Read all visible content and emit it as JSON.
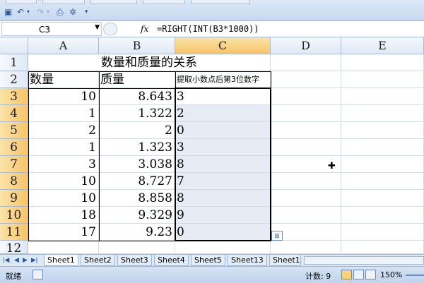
{
  "formula_bar": {
    "name_box": "C3",
    "fx_label": "fx",
    "formula": "=RIGHT(INT(B3*1000))"
  },
  "columns": [
    "A",
    "B",
    "C",
    "D",
    "E"
  ],
  "rows": [
    "1",
    "2",
    "3",
    "4",
    "5",
    "6",
    "7",
    "8",
    "9",
    "10",
    "11",
    "12"
  ],
  "sheet": {
    "title": "数量和质量的关系",
    "header_a": "数量",
    "header_b": "质量",
    "header_c": "提取小数点后第3位数字",
    "data": [
      {
        "a": "10",
        "b": "8.643",
        "c": "3"
      },
      {
        "a": "1",
        "b": "1.322",
        "c": "2"
      },
      {
        "a": "2",
        "b": "2",
        "c": "0"
      },
      {
        "a": "1",
        "b": "1.323",
        "c": "3"
      },
      {
        "a": "3",
        "b": "3.038",
        "c": "8"
      },
      {
        "a": "10",
        "b": "8.727",
        "c": "7"
      },
      {
        "a": "10",
        "b": "8.858",
        "c": "8"
      },
      {
        "a": "18",
        "b": "9.329",
        "c": "9"
      },
      {
        "a": "17",
        "b": "9.23",
        "c": "0"
      }
    ]
  },
  "sheet_tabs": [
    "Sheet1",
    "Sheet2",
    "Sheet3",
    "Sheet4",
    "Sheet5",
    "Sheet13",
    "Sheet1"
  ],
  "status_bar": {
    "ready": "就绪",
    "count": "计数: 9",
    "zoom": "150%"
  }
}
